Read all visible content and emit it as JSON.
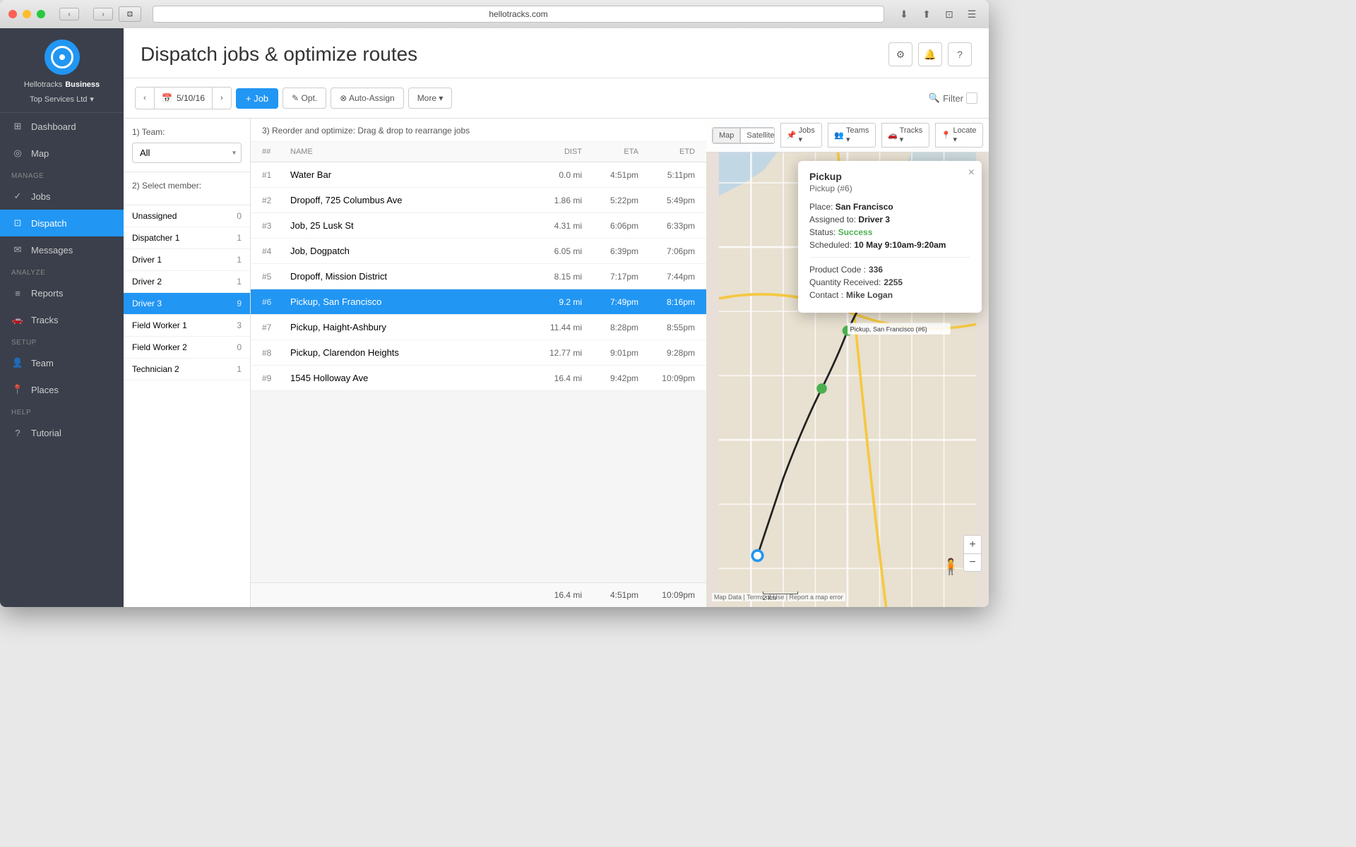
{
  "window": {
    "url": "hellotracks.com",
    "dots": [
      "red",
      "yellow",
      "green"
    ]
  },
  "app": {
    "name": "Hellotracks",
    "name_bold": "Business",
    "org": "Top Services Ltd"
  },
  "sidebar": {
    "sections": [
      {
        "label": "",
        "items": [
          {
            "id": "dashboard",
            "label": "Dashboard",
            "icon": "⊞"
          },
          {
            "id": "map",
            "label": "Map",
            "icon": "◎"
          }
        ]
      },
      {
        "label": "Manage",
        "items": [
          {
            "id": "jobs",
            "label": "Jobs",
            "icon": "✓"
          },
          {
            "id": "dispatch",
            "label": "Dispatch",
            "icon": "⊡",
            "active": true
          },
          {
            "id": "messages",
            "label": "Messages",
            "icon": "✉"
          }
        ]
      },
      {
        "label": "Analyze",
        "items": [
          {
            "id": "reports",
            "label": "Reports",
            "icon": "📋"
          },
          {
            "id": "tracks",
            "label": "Tracks",
            "icon": "🚗"
          }
        ]
      },
      {
        "label": "Setup",
        "items": [
          {
            "id": "team",
            "label": "Team",
            "icon": "👤"
          },
          {
            "id": "places",
            "label": "Places",
            "icon": "📍"
          }
        ]
      },
      {
        "label": "Help",
        "items": [
          {
            "id": "tutorial",
            "label": "Tutorial",
            "icon": "?"
          }
        ]
      }
    ]
  },
  "page": {
    "title": "Dispatch jobs & optimize routes"
  },
  "header_buttons": {
    "settings": "⚙",
    "bell": "🔔",
    "help": "?"
  },
  "toolbar": {
    "date": "5/10/16",
    "add_job": "+ Job",
    "optimize": "✎ Opt.",
    "auto_assign": "⊗ Auto-Assign",
    "more": "More ▾",
    "filter": "Filter"
  },
  "team_section": {
    "label": "1) Team:",
    "options": [
      "All"
    ],
    "selected": "All"
  },
  "member_section": {
    "label": "2) Select member:",
    "members": [
      {
        "name": "Unassigned",
        "count": 0
      },
      {
        "name": "Dispatcher 1",
        "count": 1
      },
      {
        "name": "Driver 1",
        "count": 1
      },
      {
        "name": "Driver 2",
        "count": 1
      },
      {
        "name": "Driver 3",
        "count": 9,
        "active": true
      },
      {
        "name": "Field Worker 1",
        "count": 3
      },
      {
        "name": "Field Worker 2",
        "count": 0
      },
      {
        "name": "Technician 2",
        "count": 1
      }
    ]
  },
  "jobs_section": {
    "title": "3) Reorder and optimize: Drag & drop to rearrange jobs",
    "columns": {
      "num": "##",
      "name": "Name",
      "dist": "Dist",
      "eta": "ETA",
      "etd": "ETD"
    },
    "jobs": [
      {
        "num": "#1",
        "name": "Water Bar",
        "dist": "0.0 mi",
        "eta": "4:51pm",
        "etd": "5:11pm"
      },
      {
        "num": "#2",
        "name": "Dropoff, 725 Columbus Ave",
        "dist": "1.86 mi",
        "eta": "5:22pm",
        "etd": "5:49pm"
      },
      {
        "num": "#3",
        "name": "Job, 25 Lusk St",
        "dist": "4.31 mi",
        "eta": "6:06pm",
        "etd": "6:33pm"
      },
      {
        "num": "#4",
        "name": "Job, Dogpatch",
        "dist": "6.05 mi",
        "eta": "6:39pm",
        "etd": "7:06pm"
      },
      {
        "num": "#5",
        "name": "Dropoff, Mission District",
        "dist": "8.15 mi",
        "eta": "7:17pm",
        "etd": "7:44pm"
      },
      {
        "num": "#6",
        "name": "Pickup, San Francisco",
        "dist": "9.2 mi",
        "eta": "7:49pm",
        "etd": "8:16pm",
        "selected": true
      },
      {
        "num": "#7",
        "name": "Pickup, Haight-Ashbury",
        "dist": "11.44 mi",
        "eta": "8:28pm",
        "etd": "8:55pm"
      },
      {
        "num": "#8",
        "name": "Pickup, Clarendon Heights",
        "dist": "12.77 mi",
        "eta": "9:01pm",
        "etd": "9:28pm"
      },
      {
        "num": "#9",
        "name": "1545 Holloway Ave",
        "dist": "16.4 mi",
        "eta": "9:42pm",
        "etd": "10:09pm"
      }
    ],
    "footer": {
      "dist": "16.4 mi",
      "eta": "4:51pm",
      "etd": "10:09pm"
    }
  },
  "map": {
    "tabs": [
      "Map",
      "Satellite"
    ],
    "buttons": [
      {
        "label": "📌 Jobs ▾",
        "id": "jobs-btn"
      },
      {
        "label": "👥 Teams ▾",
        "id": "teams-btn"
      },
      {
        "label": "🚗 Tracks ▾",
        "id": "tracks-btn"
      },
      {
        "label": "📍 Locate ▾",
        "id": "locate-btn"
      }
    ],
    "active_tab": "Map"
  },
  "popup": {
    "title": "Pickup",
    "subtitle": "Pickup (#6)",
    "place_label": "Place:",
    "place": "San Francisco",
    "assigned_label": "Assigned to:",
    "assigned": "Driver 3",
    "status_label": "Status:",
    "status": "Success",
    "scheduled_label": "Scheduled:",
    "scheduled": "10 May 9:10am-9:20am",
    "product_code_label": "Product Code :",
    "product_code": "336",
    "quantity_label": "Quantity Received:",
    "quantity": "2255",
    "contact_label": "Contact :",
    "contact": "Mike Logan"
  }
}
